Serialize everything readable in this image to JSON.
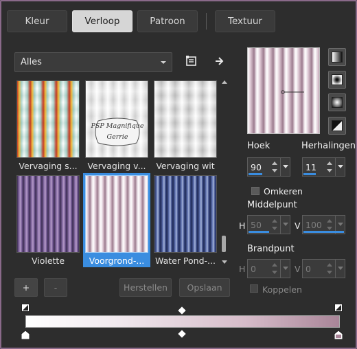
{
  "tabs": [
    {
      "label": "Kleur",
      "active": false
    },
    {
      "label": "Verloop",
      "active": true
    },
    {
      "label": "Patroon",
      "active": false
    },
    {
      "label": "Textuur",
      "active": false
    }
  ],
  "category_dropdown": {
    "selected": "Alles"
  },
  "toolbar_icons": [
    "gradient-editor-icon",
    "arrow-right-icon"
  ],
  "gallery": {
    "tiles": [
      {
        "label": "Vervaging s...",
        "selected": false
      },
      {
        "label": "Vervaging v...",
        "selected": false,
        "watermark_line1": "PSP Magnifique",
        "watermark_line2": "Gerrie"
      },
      {
        "label": "Vervaging wit",
        "selected": false
      },
      {
        "label": "Violette",
        "selected": false
      },
      {
        "label": "Voorgrond-...",
        "selected": true
      },
      {
        "label": "Water Pond-...",
        "selected": false
      }
    ]
  },
  "angle": {
    "label": "Hoek",
    "value": "90"
  },
  "repeats": {
    "label": "Herhalingen",
    "value": "11"
  },
  "invert": {
    "label": "Omkeren",
    "checked": false
  },
  "center_point": {
    "label": "Middelpunt",
    "h_label": "H",
    "h_value": "50",
    "v_label": "V",
    "v_value": "100"
  },
  "focal_point": {
    "label": "Brandpunt",
    "h_label": "H",
    "h_value": "0",
    "v_label": "V",
    "v_value": "0"
  },
  "link": {
    "label": "Koppelen",
    "checked": false
  },
  "buttons": {
    "add": "+",
    "remove": "-",
    "reset": "Herstellen",
    "save": "Opslaan"
  },
  "gradient_style_buttons": [
    "linear-gradient-icon",
    "rectangular-gradient-icon",
    "radial-gradient-icon",
    "sunburst-gradient-icon"
  ],
  "colors": {
    "accent": "#3a8de0",
    "gradient_start": "#ffffff",
    "gradient_end": "#a98598",
    "frame": "#8a6a8a"
  }
}
